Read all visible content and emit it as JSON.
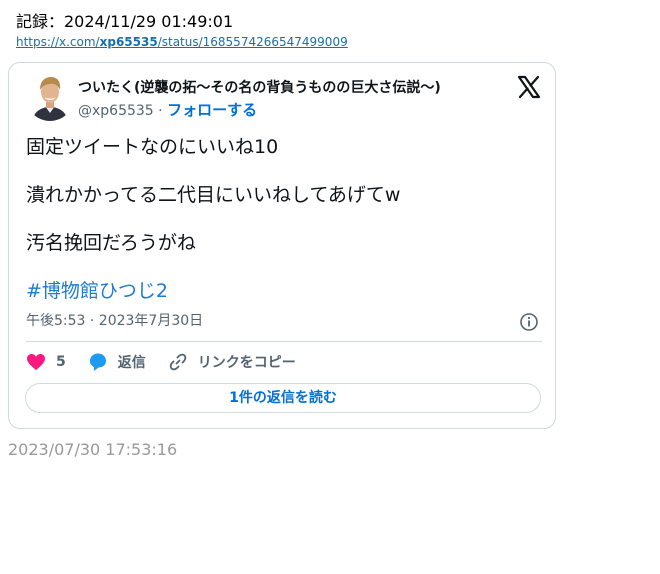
{
  "record": {
    "label": "記録：2024/11/29 01:49:01"
  },
  "source": {
    "prefix": "https://x.com/",
    "user": "xp65535",
    "suffix": "/status/1685574266547499009"
  },
  "tweet": {
    "display_name": "ついたく(逆襲の拓〜その名の背負うものの巨大さ伝説〜)",
    "handle": "@xp65535",
    "separator": " · ",
    "follow_label": "フォローする",
    "lines": [
      "固定ツイートなのにいいね10",
      "潰れかかってる二代目にいいねしてあげてw",
      "汚名挽回だろうがね"
    ],
    "hashtag": "#博物館ひつじ2",
    "time": "午後5:53 · 2023年7月30日",
    "like_count": "5",
    "reply_label": "返信",
    "copy_link_label": "リンクをコピー",
    "read_replies_label": "1件の返信を読む"
  },
  "footer": {
    "timestamp": "2023/07/30 17:53:16"
  },
  "colors": {
    "link": "#1a6fa8",
    "accent": "#006fd6",
    "like": "#f91880",
    "reply": "#1d9bf0"
  }
}
